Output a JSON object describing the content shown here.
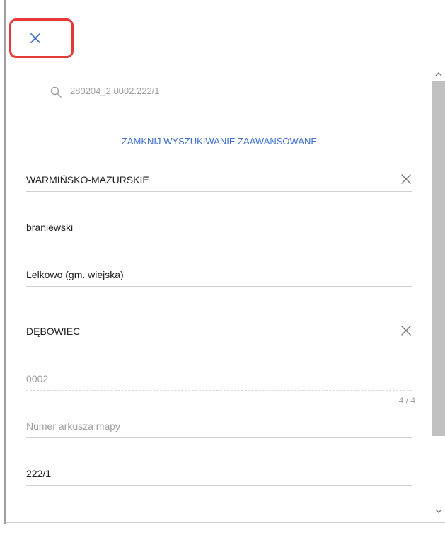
{
  "close_button": {
    "icon": "close-icon",
    "color": "#3f6fd1"
  },
  "search": {
    "icon": "search-icon",
    "value": "280204_2.0002.222/1"
  },
  "advanced_search": {
    "toggle_label": "ZAMKNIJ WYSZUKIWANIE ZAAWANSOWANE",
    "color": "#3f6fd1"
  },
  "fields": {
    "voivodeship": {
      "value": "WARMIŃSKO-MAZURSKIE"
    },
    "county": {
      "value": "braniewski"
    },
    "commune": {
      "value": "Lelkowo (gm. wiejska)"
    },
    "precinct": {
      "value": "DĘBOWIEC"
    },
    "precinct_number": {
      "value": "0002",
      "counter": "4 / 4"
    },
    "map_sheet": {
      "placeholder": "Numer arkusza mapy"
    },
    "parcel_number": {
      "value": "222/1"
    }
  },
  "accent_highlight": "#e53935"
}
